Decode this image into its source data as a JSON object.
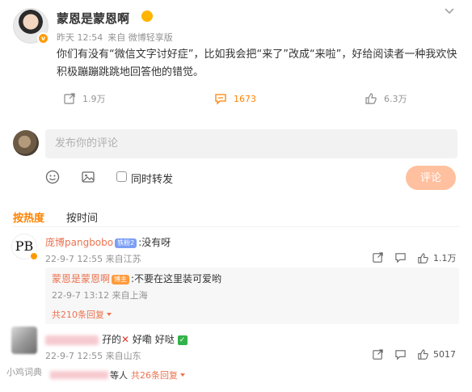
{
  "post": {
    "username": "蒙恩是蒙恩啊",
    "time": "昨天 12:54",
    "source": "来自 微博轻享版",
    "text": "你们有没有“微信文字讨好症”，比如我会把“来了”改成“来啦”，好给阅读者一种我欢快积极蹦蹦跳跳地回答他的错觉。",
    "reposts": "1.9万",
    "comments": "1673",
    "likes": "6.3万"
  },
  "composer": {
    "placeholder": "发布你的评论",
    "repost_label": "同时转发",
    "submit_label": "评论"
  },
  "tabs": {
    "hot": "按热度",
    "time": "按时间"
  },
  "comments": [
    {
      "name": "庞博pangbobo",
      "fan_badge": "铁粉2",
      "text": ":没有呀",
      "time": "22-9-7 12:55",
      "location": "来自江苏",
      "likes": "1.1万",
      "reply": {
        "name": "蒙恩是蒙恩啊",
        "author_badge": "博主",
        "text": ":不要在这里装可爱哟",
        "time": "22-9-7 13:12",
        "location": "来自上海"
      },
      "more": "共210条回复"
    },
    {
      "text_a": "孖的",
      "text_b": " 好嘞",
      "text_c": " 好哒",
      "time": "22-9-7 12:55",
      "location": "来自山东",
      "likes": "5017",
      "sub_text": "等人",
      "more": "共26条回复"
    }
  ],
  "watermark": "小鸡词典",
  "colors": {
    "accent": "#ff8200",
    "link": "#eb7350",
    "submit_bg": "#ffc09f"
  }
}
